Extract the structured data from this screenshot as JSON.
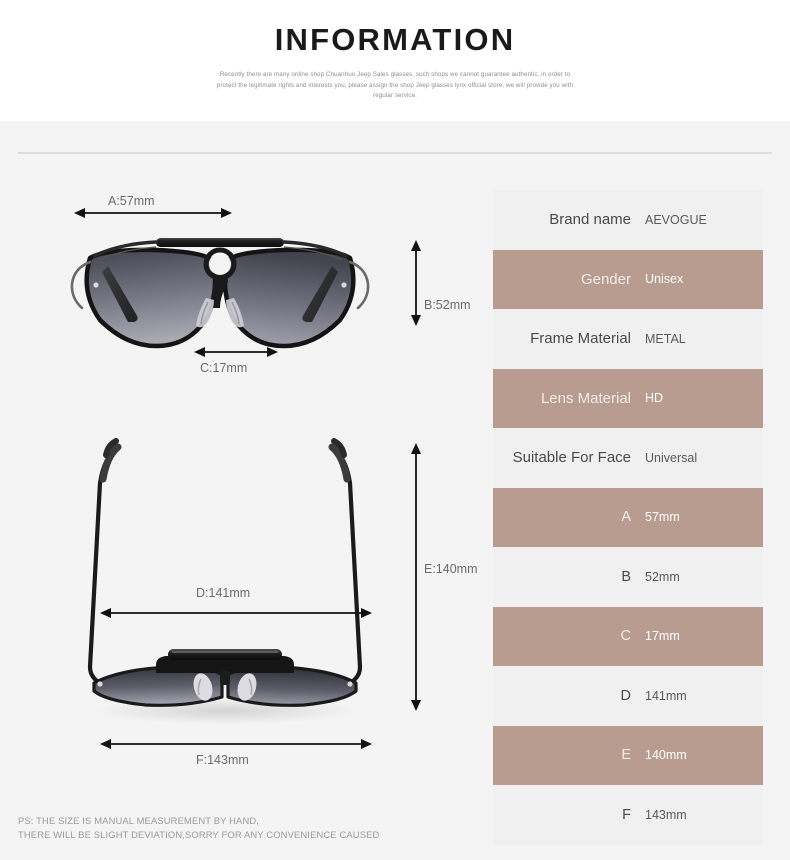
{
  "header": {
    "title": "INFORMATION",
    "subtitle": "Recently there are many online shop Chuanhuo Jeep Sales glasses, such shops we cannot guarantee authentic, in order to protect the legitimate rights and interests you, please assign the shop Jeep glasses lynx official store, we will provide you with regular service."
  },
  "diagram": {
    "front_view_label": "sunglasses-front-view",
    "top_view_label": "sunglasses-top-view",
    "measurements": [
      {
        "id": "A",
        "text": "A:57mm",
        "orientation": "horizontal"
      },
      {
        "id": "B",
        "text": "B:52mm",
        "orientation": "vertical"
      },
      {
        "id": "C",
        "text": "C:17mm",
        "orientation": "horizontal"
      },
      {
        "id": "D",
        "text": "D:141mm",
        "orientation": "horizontal"
      },
      {
        "id": "E",
        "text": "E:140mm",
        "orientation": "vertical"
      },
      {
        "id": "F",
        "text": "F:143mm",
        "orientation": "horizontal"
      }
    ]
  },
  "spec_table": {
    "rows": [
      {
        "label": "Brand name",
        "value": "AEVOGUE",
        "shade": "light"
      },
      {
        "label": "Gender",
        "value": "Unisex",
        "shade": "dark"
      },
      {
        "label": "Frame Material",
        "value": "METAL",
        "shade": "light"
      },
      {
        "label": "Lens Material",
        "value": "HD",
        "shade": "dark"
      },
      {
        "label": "Suitable For Face",
        "value": "Universal",
        "shade": "light"
      },
      {
        "label": "A",
        "value": "57mm",
        "shade": "dark"
      },
      {
        "label": "B",
        "value": "52mm",
        "shade": "light"
      },
      {
        "label": "C",
        "value": "17mm",
        "shade": "dark"
      },
      {
        "label": "D",
        "value": "141mm",
        "shade": "light"
      },
      {
        "label": "E",
        "value": "140mm",
        "shade": "dark"
      },
      {
        "label": "F",
        "value": "143mm",
        "shade": "light"
      }
    ]
  },
  "footnote": {
    "line1": "PS: THE SIZE IS MANUAL MEASUREMENT BY HAND,",
    "line2": "THERE WILL BE SLIGHT DEVIATION,SORRY FOR ANY CONVENIENCE CAUSED"
  },
  "colors": {
    "accent_taupe": "#b79c8f",
    "row_light": "#f0f0f0",
    "page_background": "#f4f4f4",
    "header_background": "#ffffff",
    "title_text": "#1a1a1a",
    "label_text": "#6b6b6b"
  }
}
